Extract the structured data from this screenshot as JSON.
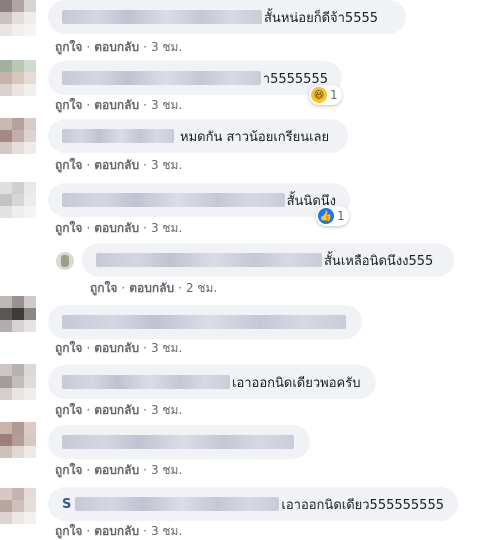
{
  "comments": [
    {
      "text": "สั้นหน่อยก็ดีจ้า5555",
      "like": "ถูกใจ",
      "reply": "ตอบกลับ",
      "time": "3 ชม."
    },
    {
      "text": "า5555555",
      "like": "ถูกใจ",
      "reply": "ตอบกลับ",
      "time": "3 ชม.",
      "reaction": {
        "type": "haha-icon",
        "count": "1"
      }
    },
    {
      "text": "หมดกัน สาวน้อยเกรียนเลย",
      "like": "ถูกใจ",
      "reply": "ตอบกลับ",
      "time": "3 ชม."
    },
    {
      "text": "สั้นนิดนึง",
      "like": "ถูกใจ",
      "reply": "ตอบกลับ",
      "time": "3 ชม.",
      "reaction": {
        "type": "like-icon",
        "count": "1"
      }
    },
    {
      "text": "สั้นเหลือนิดนึงง555",
      "like": "ถูกใจ",
      "reply": "ตอบกลับ",
      "time": "2 ชม."
    },
    {
      "text": "",
      "like": "ถูกใจ",
      "reply": "ตอบกลับ",
      "time": "3 ชม."
    },
    {
      "text": "เอาออกนิดเดียวพอครับ",
      "like": "ถูกใจ",
      "reply": "ตอบกลับ",
      "time": "3 ชม."
    },
    {
      "text": "",
      "like": "ถูกใจ",
      "reply": "ตอบกลับ",
      "time": "3 ชม."
    },
    {
      "text": "เอาออกนิดเดียว555555555",
      "prefix": "S",
      "like": "ถูกใจ",
      "reply": "ตอบกลับ",
      "time": "3 ชม."
    }
  ],
  "theme": {
    "bubble": "#f0f2f5",
    "meta": "#65676b",
    "like_blue": "#1877f2",
    "haha_yellow": "#f7c32b"
  }
}
